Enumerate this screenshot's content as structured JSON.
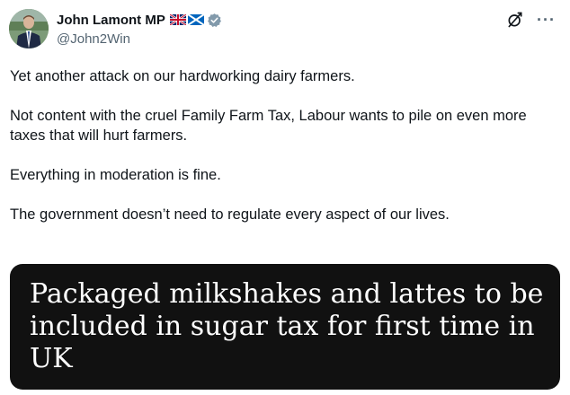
{
  "author": {
    "display_name": "John Lamont MP",
    "handle": "@John2Win",
    "flags": [
      "uk-flag",
      "scotland-flag"
    ],
    "verified": true,
    "verified_color": "#829aab"
  },
  "actions": {
    "grok_icon": "grok-icon",
    "more_label": "···"
  },
  "tweet": {
    "paragraphs": [
      "Yet another attack on our hardworking dairy farmers.",
      "Not content with the cruel Family Farm Tax, Labour wants to pile on even more taxes that will hurt farmers.",
      "Everything in moderation is fine.",
      "The government doesn’t need to regulate every aspect of our lives."
    ]
  },
  "media": {
    "headline": "Packaged milkshakes and lattes to be included in sugar tax for first time in UK",
    "background": "#111111"
  }
}
